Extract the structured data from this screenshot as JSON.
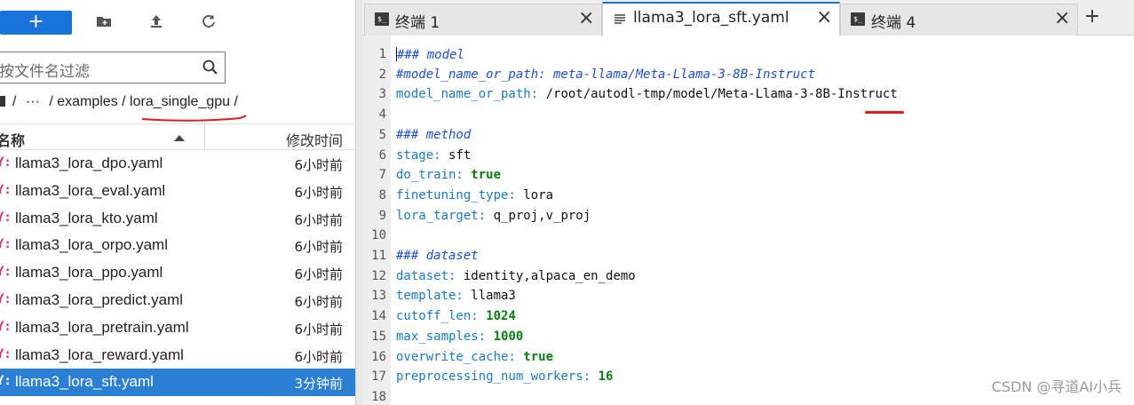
{
  "file_browser": {
    "toolbar": {
      "new_label": "+",
      "icons": [
        "new-folder-icon",
        "upload-icon",
        "refresh-icon"
      ]
    },
    "filter": {
      "placeholder": "按文件名过滤"
    },
    "breadcrumb": {
      "ellipsis": "···",
      "path_mid": "/ examples /",
      "current": "lora_single_gpu",
      "trail": "/"
    },
    "columns": {
      "name": "名称",
      "modified": "修改时间"
    },
    "files": [
      {
        "name": "llama3_lora_dpo.yaml",
        "time": "6小时前"
      },
      {
        "name": "llama3_lora_eval.yaml",
        "time": "6小时前"
      },
      {
        "name": "llama3_lora_kto.yaml",
        "time": "6小时前"
      },
      {
        "name": "llama3_lora_orpo.yaml",
        "time": "6小时前"
      },
      {
        "name": "llama3_lora_ppo.yaml",
        "time": "6小时前"
      },
      {
        "name": "llama3_lora_predict.yaml",
        "time": "6小时前"
      },
      {
        "name": "llama3_lora_pretrain.yaml",
        "time": "6小时前"
      },
      {
        "name": "llama3_lora_reward.yaml",
        "time": "6小时前"
      },
      {
        "name": "llama3_lora_sft.yaml",
        "time": "3分钟前",
        "selected": true
      }
    ]
  },
  "tabs": [
    {
      "label": "终端 1",
      "type": "terminal"
    },
    {
      "label": "llama3_lora_sft.yaml",
      "type": "file",
      "active": true
    },
    {
      "label": "终端 4",
      "type": "terminal"
    }
  ],
  "editor": {
    "lines": [
      {
        "n": "1",
        "parts": [
          [
            "comment",
            "### model"
          ]
        ],
        "cursor": true
      },
      {
        "n": "2",
        "parts": [
          [
            "comment",
            "#model_name_or_path: meta-llama/Meta-Llama-3-8B-Instruct"
          ]
        ]
      },
      {
        "n": "3",
        "parts": [
          [
            "key",
            "model_name_or_path:"
          ],
          [
            "plain",
            " /root/autodl-tmp/model/Meta-Llama-3-8B-Instruct"
          ]
        ]
      },
      {
        "n": "4",
        "parts": []
      },
      {
        "n": "5",
        "parts": [
          [
            "comment",
            "### method"
          ]
        ]
      },
      {
        "n": "6",
        "parts": [
          [
            "key",
            "stage:"
          ],
          [
            "plain",
            " sft"
          ]
        ]
      },
      {
        "n": "7",
        "parts": [
          [
            "key",
            "do_train:"
          ],
          [
            "plain",
            " "
          ],
          [
            "bool",
            "true"
          ]
        ]
      },
      {
        "n": "8",
        "parts": [
          [
            "key",
            "finetuning_type:"
          ],
          [
            "plain",
            " lora"
          ]
        ]
      },
      {
        "n": "9",
        "parts": [
          [
            "key",
            "lora_target:"
          ],
          [
            "plain",
            " q_proj,v_proj"
          ]
        ]
      },
      {
        "n": "10",
        "parts": []
      },
      {
        "n": "11",
        "parts": [
          [
            "comment",
            "### dataset"
          ]
        ]
      },
      {
        "n": "12",
        "parts": [
          [
            "key",
            "dataset:"
          ],
          [
            "plain",
            " identity,alpaca_en_demo"
          ]
        ]
      },
      {
        "n": "13",
        "parts": [
          [
            "key",
            "template:"
          ],
          [
            "plain",
            " llama3"
          ]
        ]
      },
      {
        "n": "14",
        "parts": [
          [
            "key",
            "cutoff_len:"
          ],
          [
            "plain",
            " "
          ],
          [
            "num",
            "1024"
          ]
        ]
      },
      {
        "n": "15",
        "parts": [
          [
            "key",
            "max_samples:"
          ],
          [
            "plain",
            " "
          ],
          [
            "num",
            "1000"
          ]
        ]
      },
      {
        "n": "16",
        "parts": [
          [
            "key",
            "overwrite_cache:"
          ],
          [
            "plain",
            " "
          ],
          [
            "bool",
            "true"
          ]
        ]
      },
      {
        "n": "17",
        "parts": [
          [
            "key",
            "preprocessing_num_workers:"
          ],
          [
            "plain",
            " "
          ],
          [
            "num",
            "16"
          ]
        ]
      },
      {
        "n": "18",
        "parts": []
      }
    ]
  },
  "watermark": "CSDN @寻道AI小兵",
  "colors": {
    "accent": "#1a73d9",
    "selected_row": "#2b7fd4",
    "annotation_red": "#e01b1b"
  }
}
